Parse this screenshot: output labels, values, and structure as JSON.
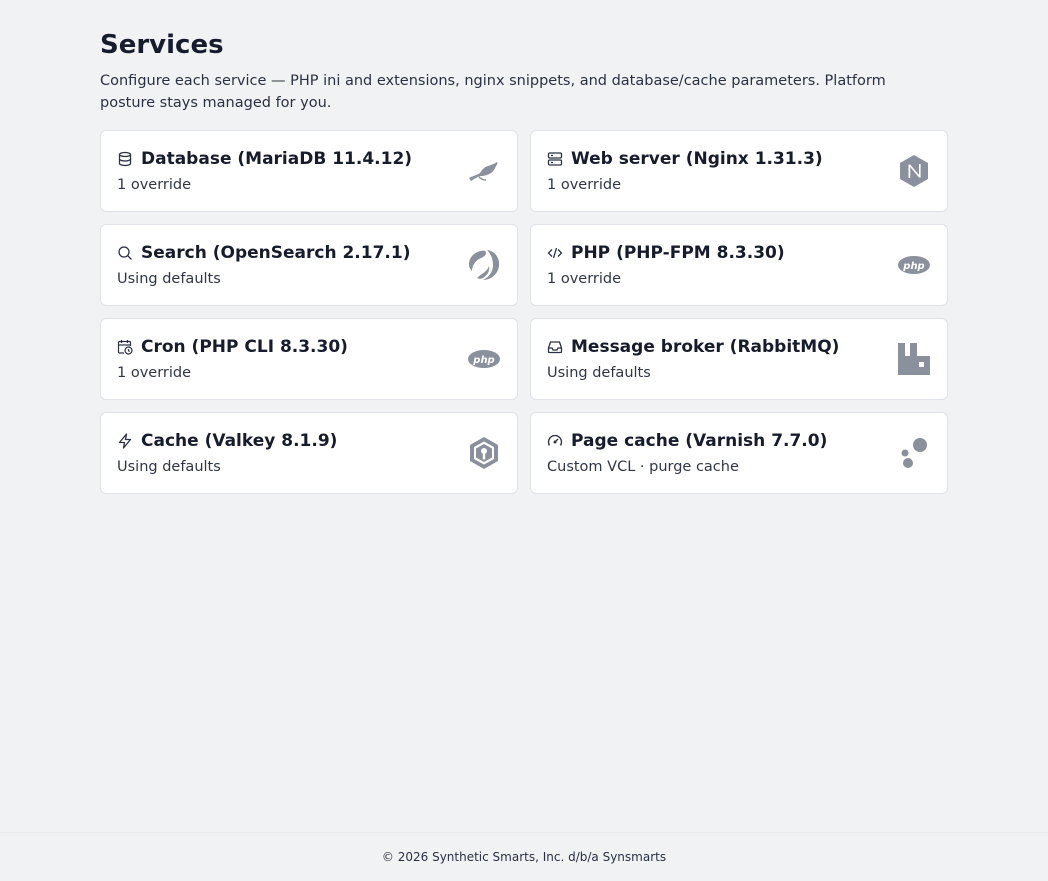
{
  "header": {
    "title": "Services",
    "subtitle": "Configure each service — PHP ini and extensions, nginx snippets, and database/cache parameters. Platform posture stays managed for you."
  },
  "services": [
    {
      "title": "Database (MariaDB 11.4.12)",
      "status": "1 override",
      "icon": "database-icon",
      "logo": "mariadb-logo"
    },
    {
      "title": "Web server (Nginx 1.31.3)",
      "status": "1 override",
      "icon": "server-icon",
      "logo": "nginx-logo"
    },
    {
      "title": "Search (OpenSearch 2.17.1)",
      "status": "Using defaults",
      "icon": "search-icon",
      "logo": "opensearch-logo"
    },
    {
      "title": "PHP (PHP-FPM 8.3.30)",
      "status": "1 override",
      "icon": "code-icon",
      "logo": "php-logo"
    },
    {
      "title": "Cron (PHP CLI 8.3.30)",
      "status": "1 override",
      "icon": "calendar-clock-icon",
      "logo": "php-logo"
    },
    {
      "title": "Message broker (RabbitMQ)",
      "status": "Using defaults",
      "icon": "inbox-icon",
      "logo": "rabbitmq-logo"
    },
    {
      "title": "Cache (Valkey 8.1.9)",
      "status": "Using defaults",
      "icon": "lightning-icon",
      "logo": "valkey-logo"
    },
    {
      "title": "Page cache (Varnish 7.7.0)",
      "status": "Custom VCL · purge cache",
      "icon": "gauge-icon",
      "logo": "varnish-logo"
    }
  ],
  "footer": {
    "text": "© 2026 Synthetic Smarts, Inc. d/b/a Synsmarts"
  },
  "colors": {
    "background": "#f1f2f4",
    "card": "#ffffff",
    "border": "#dfe2e7",
    "text": "#161c2b",
    "logo_gray": "#8a919c"
  }
}
